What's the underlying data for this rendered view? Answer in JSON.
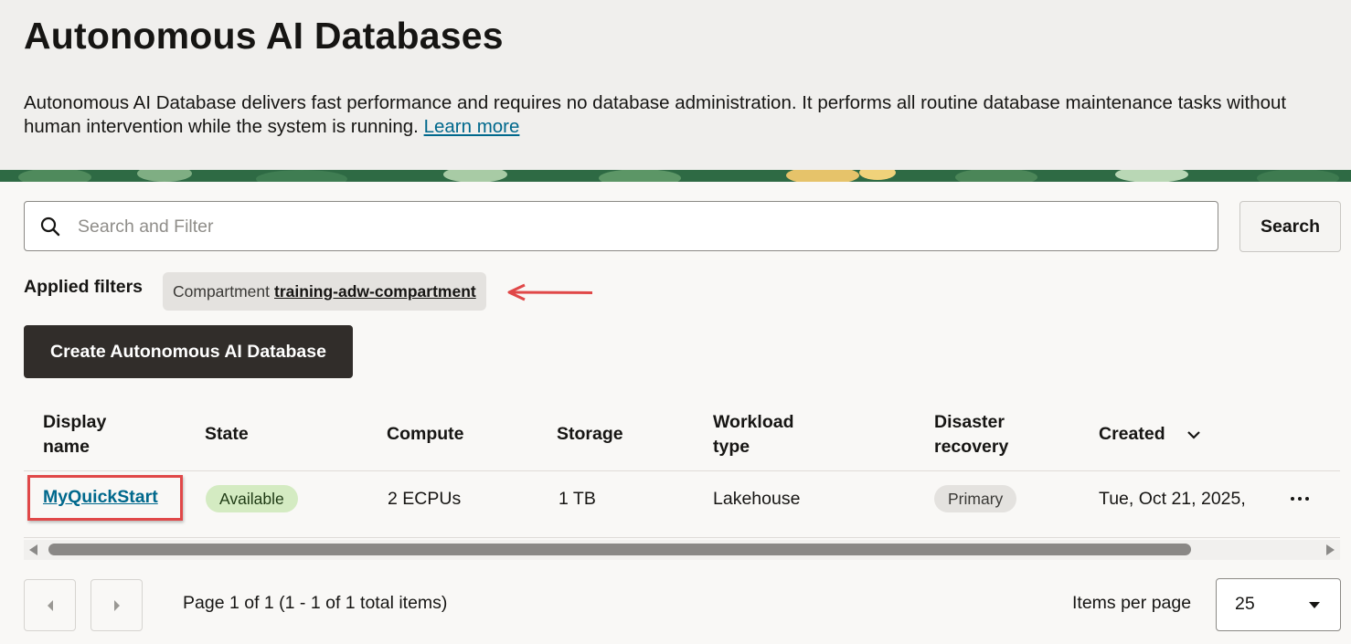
{
  "header": {
    "title": "Autonomous AI Databases",
    "description": "Autonomous AI Database delivers fast performance and requires no database administration. It performs all routine database maintenance tasks without human intervention while the system is running.",
    "learn_more": "Learn more"
  },
  "search": {
    "placeholder": "Search and Filter",
    "button_label": "Search",
    "icon": "search-icon"
  },
  "filters": {
    "label": "Applied filters",
    "chips": [
      {
        "key": "Compartment",
        "value": "training-adw-compartment"
      }
    ]
  },
  "actions": {
    "create_label": "Create Autonomous AI Database"
  },
  "table": {
    "columns": [
      "Display name",
      "State",
      "Compute",
      "Storage",
      "Workload type",
      "Disaster recovery",
      "Created"
    ],
    "rows": [
      {
        "display_name": "MyQuickStart",
        "state": "Available",
        "compute": "2 ECPUs",
        "storage": "1 TB",
        "workload_type": "Lakehouse",
        "disaster_recovery": "Primary",
        "created": "Tue, Oct 21, 2025,"
      }
    ]
  },
  "pagination": {
    "info": "Page 1 of 1 (1 - 1 of 1 total items)",
    "items_per_page_label": "Items per page",
    "items_per_page": "25"
  },
  "colors": {
    "link": "#00688c",
    "primary_button": "#312d2a",
    "available_badge": "#d4ebc2",
    "annotation": "#e04848"
  }
}
